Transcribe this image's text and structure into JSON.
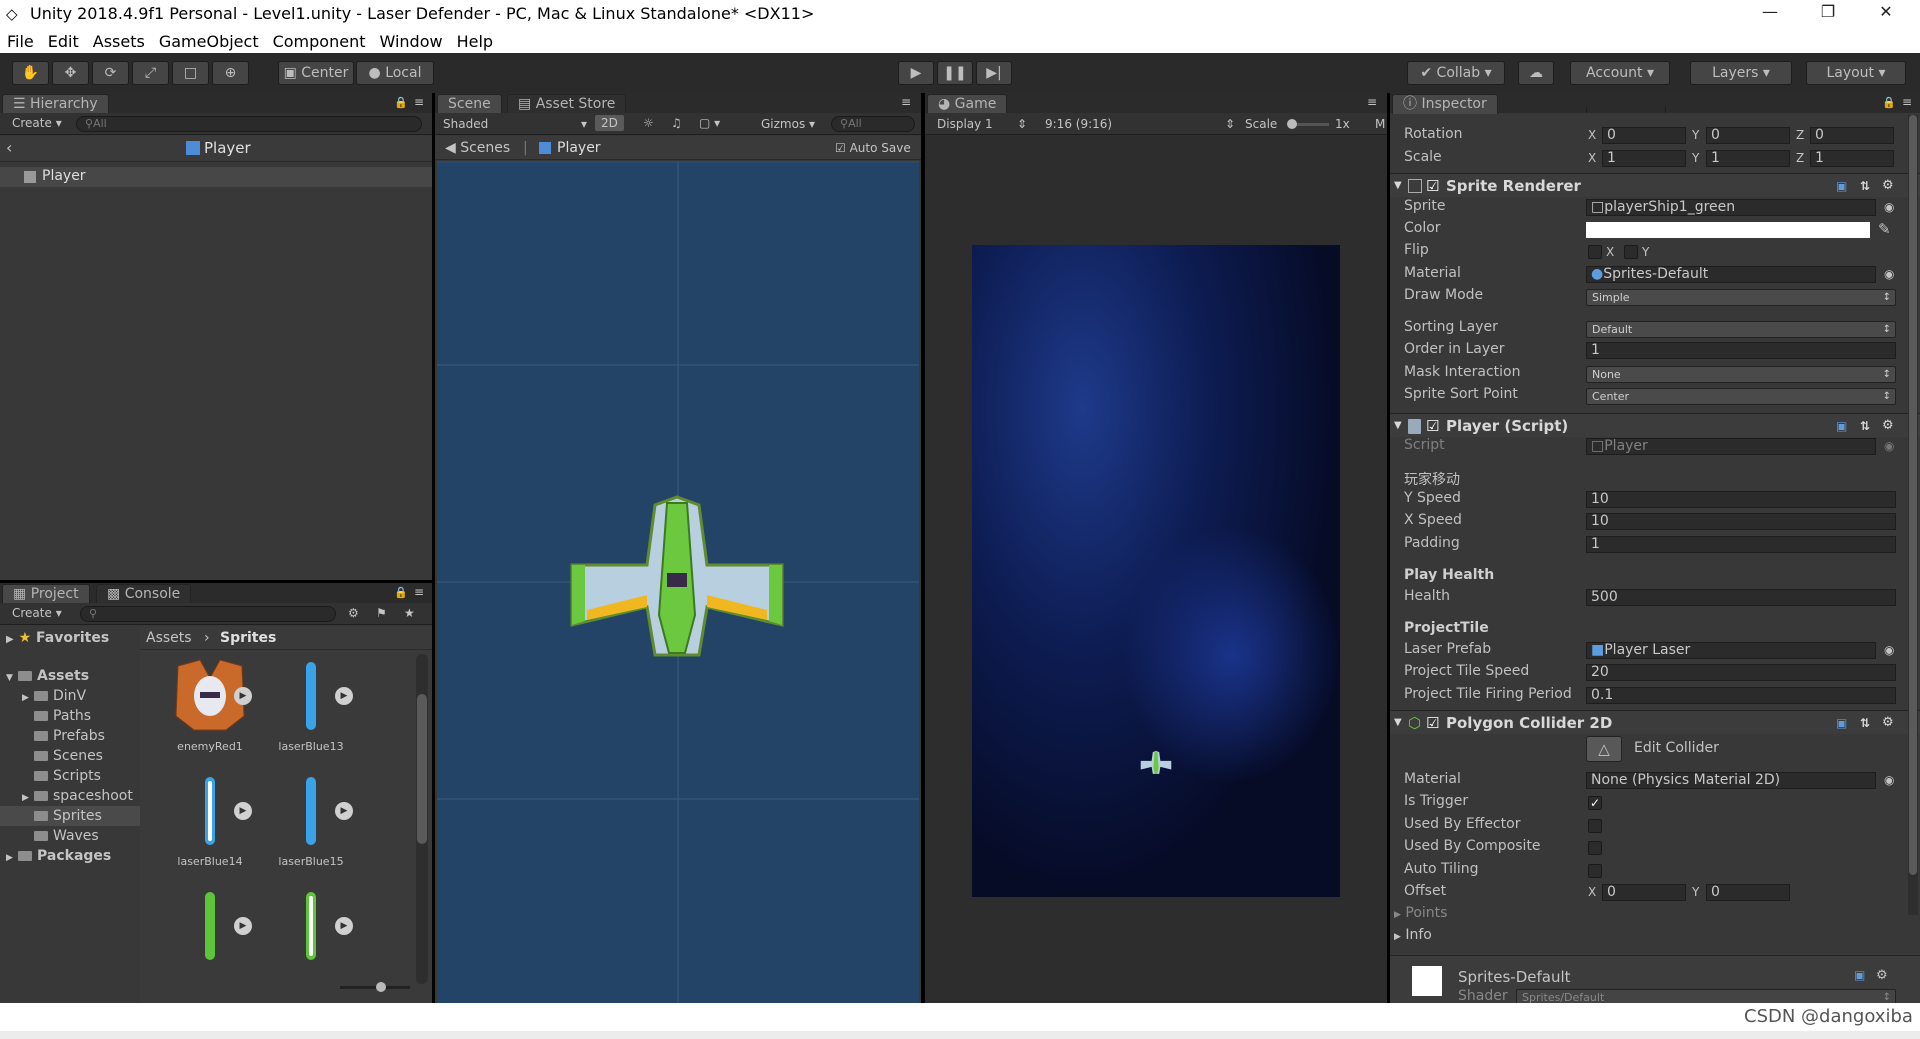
{
  "window": {
    "title": "Unity 2018.4.9f1 Personal - Level1.unity - Laser Defender - PC, Mac & Linux Standalone* <DX11>",
    "minimize": "—",
    "maximize": "❐",
    "close": "✕"
  },
  "menu": [
    "File",
    "Edit",
    "Assets",
    "GameObject",
    "Component",
    "Window",
    "Help"
  ],
  "toolbar": {
    "center_label": "Center",
    "local_label": "Local",
    "collab_label": "Collab ▾",
    "account_label": "Account",
    "layers_label": "Layers",
    "layout_label": "Layout"
  },
  "hierarchy": {
    "tab": "Hierarchy",
    "create": "Create",
    "search_placeholder": "All",
    "breadcrumb": "Player",
    "items": [
      "Player"
    ]
  },
  "scene": {
    "tab": "Scene",
    "asset_store_tab": "Asset Store",
    "shading": "Shaded",
    "mode_2d": "2D",
    "gizmos": "Gizmos",
    "search_placeholder": "All",
    "crumb_scenes": "Scenes",
    "crumb_player": "Player",
    "autosave": "Auto Save"
  },
  "game": {
    "tab": "Game",
    "display": "Display 1",
    "aspect": "9:16 (9:16)",
    "scale_label": "Scale",
    "scale_value": "1x",
    "trailing": "M"
  },
  "project": {
    "tab": "Project",
    "console_tab": "Console",
    "create": "Create",
    "favorites": "Favorites",
    "breadcrumb_root": "Assets",
    "breadcrumb_current": "Sprites",
    "tree": [
      {
        "label": "Assets",
        "depth": 0,
        "bold": true
      },
      {
        "label": "DinV",
        "depth": 1
      },
      {
        "label": "Paths",
        "depth": 1
      },
      {
        "label": "Prefabs",
        "depth": 1
      },
      {
        "label": "Scenes",
        "depth": 1
      },
      {
        "label": "Scripts",
        "depth": 1
      },
      {
        "label": "spaceshoot",
        "depth": 1
      },
      {
        "label": "Sprites",
        "depth": 1,
        "selected": true
      },
      {
        "label": "Waves",
        "depth": 1
      },
      {
        "label": "Packages",
        "depth": 0,
        "bold": true
      }
    ],
    "assets": [
      {
        "name": "enemyRed1",
        "kind": "ship"
      },
      {
        "name": "laserBlue13",
        "kind": "laser",
        "color": "#3aa3e8"
      },
      {
        "name": "laserBlue14",
        "kind": "laser-outline",
        "color": "#3aa3e8"
      },
      {
        "name": "laserBlue15",
        "kind": "laser",
        "color": "#3aa3e8"
      },
      {
        "name": "",
        "kind": "laser",
        "color": "#5cc53a"
      },
      {
        "name": "",
        "kind": "laser-outline",
        "color": "#5cc53a"
      }
    ]
  },
  "inspector": {
    "tab": "Inspector",
    "transform": {
      "rotation_label": "Rotation",
      "scale_label": "Scale",
      "rotation": [
        "0",
        "0",
        "0"
      ],
      "scale": [
        "1",
        "1",
        "1"
      ],
      "axis": [
        "X",
        "Y",
        "Z"
      ]
    },
    "sprite_renderer": {
      "title": "Sprite Renderer",
      "sprite_label": "Sprite",
      "sprite": "playerShip1_green",
      "color_label": "Color",
      "flip_label": "Flip",
      "flip_x": "X",
      "flip_y": "Y",
      "material_label": "Material",
      "material": "Sprites-Default",
      "draw_mode_label": "Draw Mode",
      "draw_mode": "Simple",
      "sorting_layer_label": "Sorting Layer",
      "sorting_layer": "Default",
      "order_label": "Order in Layer",
      "order": "1",
      "mask_label": "Mask Interaction",
      "mask": "None",
      "sort_point_label": "Sprite Sort Point",
      "sort_point": "Center"
    },
    "player_script": {
      "title": "Player (Script)",
      "script_label": "Script",
      "script": "Player",
      "header_move": "玩家移动",
      "y_speed_label": "Y Speed",
      "y_speed": "10",
      "x_speed_label": "X Speed",
      "x_speed": "10",
      "padding_label": "Padding",
      "padding": "1",
      "header_health": "Play Health",
      "health_label": "Health",
      "health": "500",
      "header_projectile": "ProjectTile",
      "laser_prefab_label": "Laser Prefab",
      "laser_prefab": "Player Laser",
      "speed_label": "Project Tile Speed",
      "speed": "20",
      "period_label": "Project Tile Firing Period",
      "period": "0.1"
    },
    "polygon_collider": {
      "title": "Polygon Collider 2D",
      "edit_collider": "Edit Collider",
      "material_label": "Material",
      "material": "None (Physics Material 2D)",
      "is_trigger_label": "Is Trigger",
      "used_by_effector_label": "Used By Effector",
      "used_by_composite_label": "Used By Composite",
      "auto_tiling_label": "Auto Tiling",
      "offset_label": "Offset",
      "offset_x": "0",
      "offset_y": "0",
      "points_label": "Points",
      "info_label": "Info"
    },
    "material_footer": {
      "name": "Sprites-Default",
      "shader_label": "Shader",
      "shader": "Sprites/Default"
    }
  },
  "watermark": "CSDN @dangoxiba",
  "colors": {
    "editor_bg": "#383838",
    "scene_bg": "#234466",
    "ship_green": "#6cc83f",
    "space": "#0b1640"
  }
}
